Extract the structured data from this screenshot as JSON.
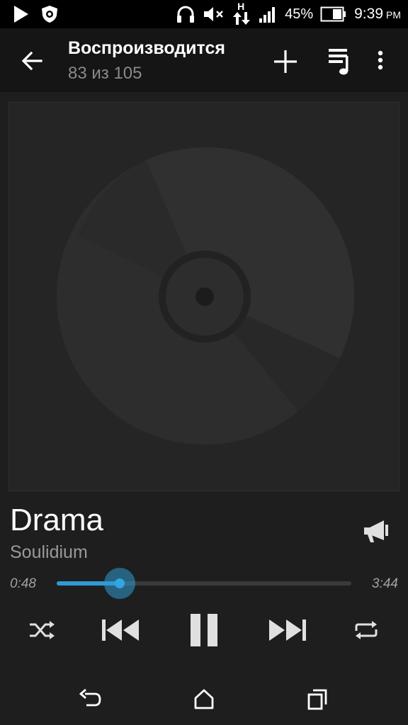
{
  "status_bar": {
    "battery_percent": "45%",
    "time": "9:39",
    "ampm": "PM",
    "network_label": "H",
    "icons": [
      "play-store-icon",
      "security-shield-icon",
      "headphones-icon",
      "volume-muted-icon",
      "data-arrows-icon",
      "signal-icon",
      "battery-icon"
    ]
  },
  "header": {
    "title": "Воспроизводится",
    "subtitle": "83 из 105"
  },
  "track": {
    "title": "Drama",
    "artist": "Soulidium",
    "elapsed": "0:48",
    "duration": "3:44",
    "progress": 0.214
  },
  "controls": [
    "shuffle",
    "previous",
    "pause",
    "next",
    "repeat"
  ],
  "colors": {
    "accent": "#2f9bd3",
    "background": "#1e1e1e",
    "app_bar": "#151515"
  }
}
